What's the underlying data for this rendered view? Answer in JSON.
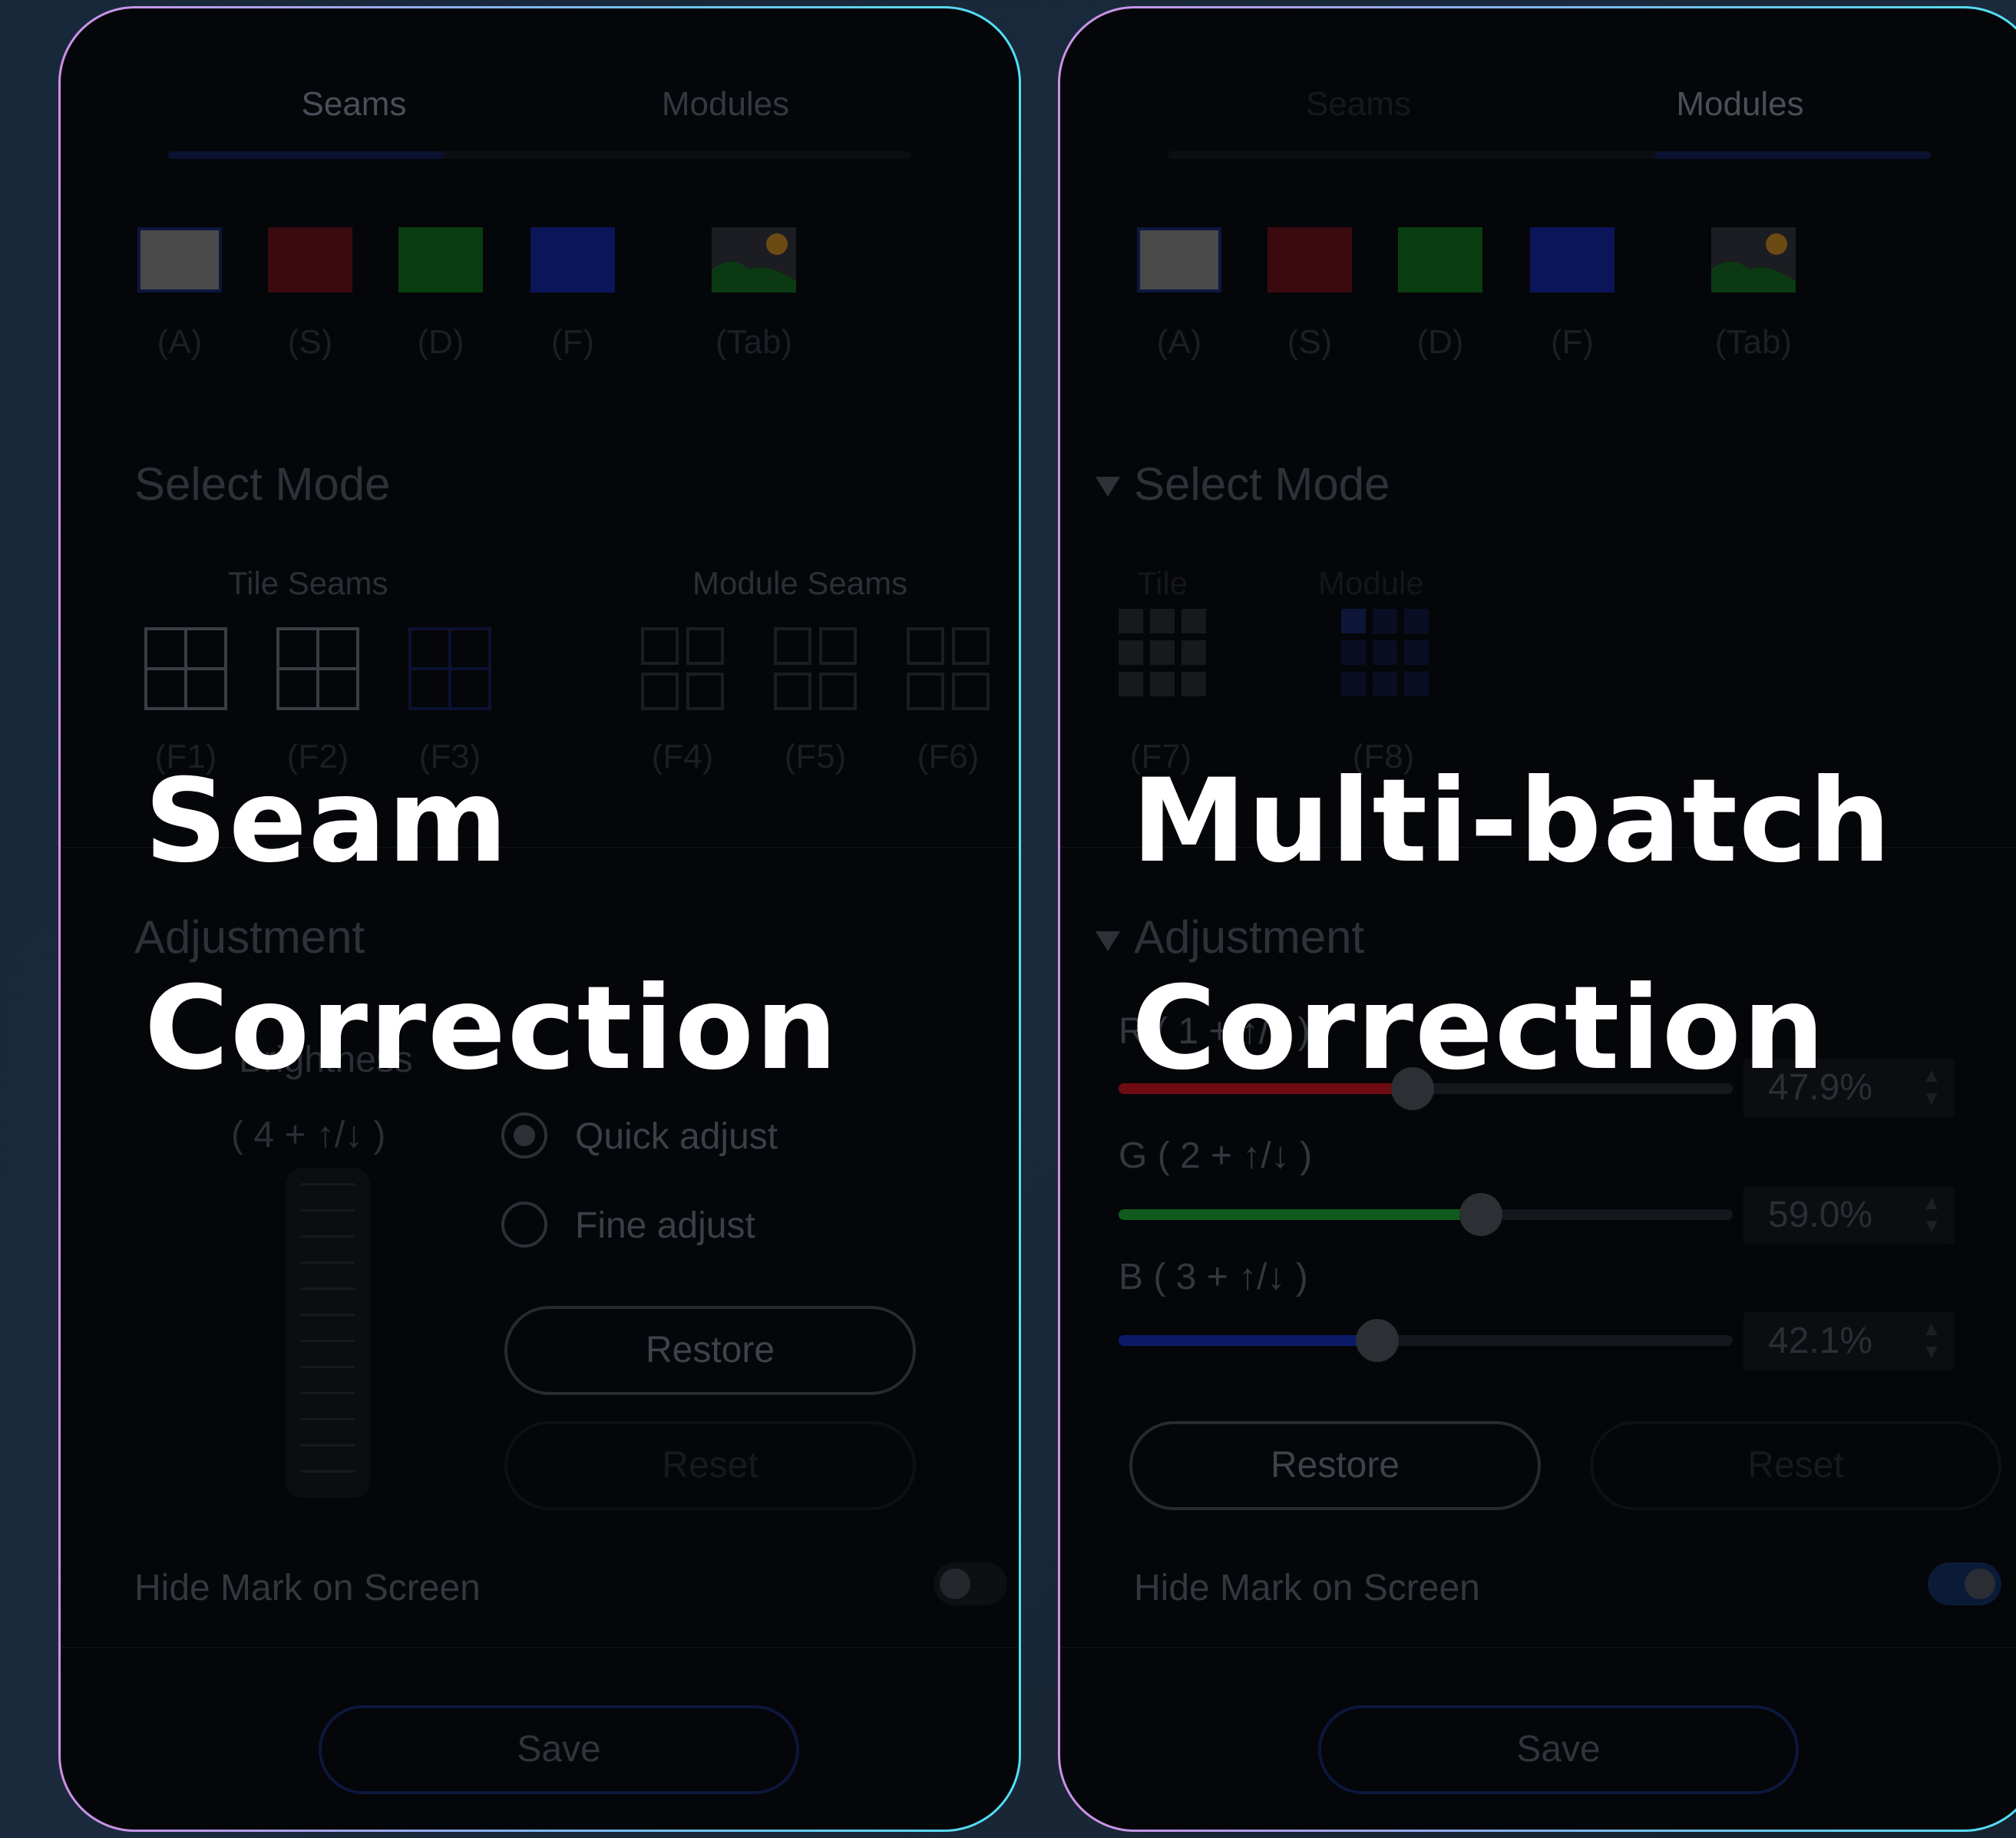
{
  "left_panel": {
    "tabs": [
      "Seams",
      "Modules"
    ],
    "active_tab": "Seams",
    "swatch_keys": [
      "(A)",
      "(S)",
      "(D)",
      "(F)",
      "(Tab)"
    ],
    "select_mode_title": "Select Mode",
    "tile_seams_label": "Tile Seams",
    "module_seams_label": "Module Seams",
    "mode_keys": [
      "(F1)",
      "(F2)",
      "(F3)",
      "(F4)",
      "(F5)",
      "(F6)"
    ],
    "adjustment_title": "Adjustment",
    "brightness_label": "Brightness",
    "brightness_hotkey": "( 4 + ↑/↓ )",
    "quick_adjust_label": "Quick adjust",
    "fine_adjust_label": "Fine adjust",
    "restore_label": "Restore",
    "reset_label": "Reset",
    "hide_mark_label": "Hide Mark on Screen",
    "hide_mark_on": false,
    "save_label": "Save",
    "overlay_line1": "Seam",
    "overlay_line2": "Correction"
  },
  "right_panel": {
    "tabs": [
      "Seams",
      "Modules"
    ],
    "active_tab": "Modules",
    "swatch_keys": [
      "(A)",
      "(S)",
      "(D)",
      "(F)",
      "(Tab)"
    ],
    "select_mode_title": "Select Mode",
    "tile_label": "Tile",
    "module_label": "Module",
    "mode_keys": [
      "(F7)",
      "(F8)"
    ],
    "adjustment_title": "Adjustment",
    "channels": [
      {
        "label": "R",
        "hotkey": "( 1 + ↑/↓ )",
        "value": 47.9,
        "display": "47.9%",
        "color": "#6e0c12"
      },
      {
        "label": "G",
        "hotkey": "( 2 + ↑/↓ )",
        "value": 59.0,
        "display": "59.0%",
        "color": "#0f5a1c"
      },
      {
        "label": "B",
        "hotkey": "( 3 + ↑/↓ )",
        "value": 42.1,
        "display": "42.1%",
        "color": "#0c1a6a"
      }
    ],
    "restore_label": "Restore",
    "reset_label": "Reset",
    "hide_mark_label": "Hide Mark on Screen",
    "hide_mark_on": true,
    "save_label": "Save",
    "overlay_line1": "Multi-batch",
    "overlay_line2": "Correction"
  },
  "colors": {
    "swatch_gray": "#4a4a4a",
    "swatch_red": "#3a0a0e",
    "swatch_green": "#0a3d10",
    "swatch_blue": "#0a155a",
    "accent_blue": "#0d173d",
    "panel_border_gradient": [
      "#d08fe8",
      "#7fb7f0",
      "#52e0f4"
    ]
  },
  "icons": [
    "image-icon",
    "tile-seam-grid-icon",
    "module-seam-grid-icon",
    "tile-grid-icon",
    "module-grid-icon",
    "stepper-icon",
    "chevron-down-icon"
  ]
}
